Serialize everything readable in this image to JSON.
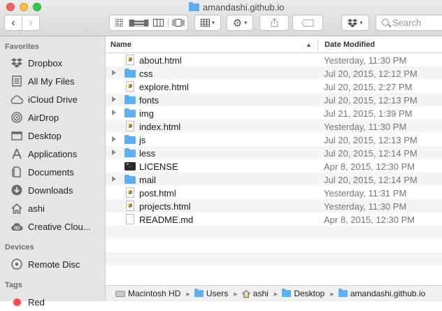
{
  "window": {
    "title": "amandashi.github.io"
  },
  "search": {
    "placeholder": "Search"
  },
  "sidebar": {
    "favorites_title": "Favorites",
    "favorites": [
      {
        "label": "Dropbox",
        "icon": "dropbox-icon"
      },
      {
        "label": "All My Files",
        "icon": "all-files-icon"
      },
      {
        "label": "iCloud Drive",
        "icon": "cloud-icon"
      },
      {
        "label": "AirDrop",
        "icon": "airdrop-icon"
      },
      {
        "label": "Desktop",
        "icon": "desktop-icon"
      },
      {
        "label": "Applications",
        "icon": "applications-icon"
      },
      {
        "label": "Documents",
        "icon": "documents-icon"
      },
      {
        "label": "Downloads",
        "icon": "downloads-icon"
      },
      {
        "label": "ashi",
        "icon": "home-icon"
      },
      {
        "label": "Creative Clou...",
        "icon": "creative-cloud-icon"
      }
    ],
    "devices_title": "Devices",
    "devices": [
      {
        "label": "Remote Disc",
        "icon": "disc-icon"
      }
    ],
    "tags_title": "Tags",
    "tags": [
      {
        "label": "Red",
        "color": "#fc4e4e"
      }
    ]
  },
  "columns": {
    "name": "Name",
    "date": "Date Modified"
  },
  "files": [
    {
      "name": "about.html",
      "date": "Yesterday, 11:30 PM",
      "kind": "html",
      "expandable": false
    },
    {
      "name": "css",
      "date": "Jul 20, 2015, 12:12 PM",
      "kind": "folder",
      "expandable": true
    },
    {
      "name": "explore.html",
      "date": "Jul 20, 2015, 2:27 PM",
      "kind": "html",
      "expandable": false
    },
    {
      "name": "fonts",
      "date": "Jul 20, 2015, 12:13 PM",
      "kind": "folder",
      "expandable": true
    },
    {
      "name": "img",
      "date": "Jul 21, 2015, 1:39 PM",
      "kind": "folder",
      "expandable": true
    },
    {
      "name": "index.html",
      "date": "Yesterday, 11:30 PM",
      "kind": "html",
      "expandable": false
    },
    {
      "name": "js",
      "date": "Jul 20, 2015, 12:13 PM",
      "kind": "folder",
      "expandable": true
    },
    {
      "name": "less",
      "date": "Jul 20, 2015, 12:14 PM",
      "kind": "folder",
      "expandable": true
    },
    {
      "name": "LICENSE",
      "date": "Apr 8, 2015, 12:30 PM",
      "kind": "terminal",
      "expandable": false
    },
    {
      "name": "mail",
      "date": "Jul 20, 2015, 12:14 PM",
      "kind": "folder",
      "expandable": true
    },
    {
      "name": "post.html",
      "date": "Yesterday, 11:31 PM",
      "kind": "html",
      "expandable": false
    },
    {
      "name": "projects.html",
      "date": "Yesterday, 11:30 PM",
      "kind": "html",
      "expandable": false
    },
    {
      "name": "README.md",
      "date": "Apr 8, 2015, 12:30 PM",
      "kind": "doc",
      "expandable": false
    }
  ],
  "pathbar": [
    {
      "label": "Macintosh HD",
      "icon": "hard-drive-icon"
    },
    {
      "label": "Users",
      "icon": "folder-icon"
    },
    {
      "label": "ashi",
      "icon": "home-icon"
    },
    {
      "label": "Desktop",
      "icon": "folder-icon"
    },
    {
      "label": "amandashi.github.io",
      "icon": "folder-icon"
    }
  ]
}
